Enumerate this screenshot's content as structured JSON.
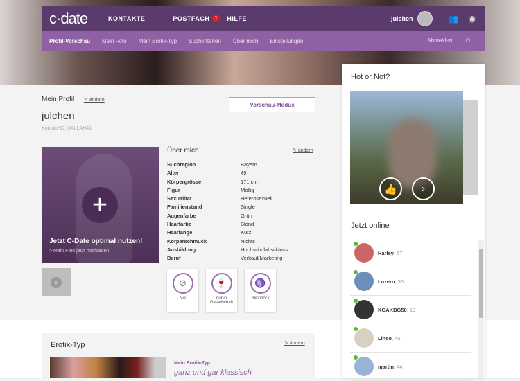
{
  "header": {
    "logo": "c·date",
    "nav": [
      "KONTAKTE",
      "POSTFACH",
      "HILFE"
    ],
    "mail_badge": "1",
    "username": "julchen"
  },
  "subnav": {
    "items": [
      "Profil-Vorschau",
      "Mein Foto",
      "Mein Erotik-Typ",
      "Suchkriterien",
      "Über mich",
      "Einstellungen"
    ],
    "logout": "Abmelden"
  },
  "profile": {
    "title": "Mein Profil",
    "edit": "ändern",
    "name": "julchen",
    "contact_id": "Kontakt-ID: UALLAH41",
    "preview_button": "Vorschau-Modus",
    "photo_title": "Jetzt C-Date optimal nutzen!",
    "photo_link": "> Mein Foto jetzt hochladen"
  },
  "about": {
    "title": "Über mich",
    "edit": "ändern",
    "rows": [
      {
        "k": "Suchregion",
        "v": "Bayern"
      },
      {
        "k": "Alter",
        "v": "49"
      },
      {
        "k": "Körpergrösse",
        "v": "171 cm"
      },
      {
        "k": "Figur",
        "v": "Mollig"
      },
      {
        "k": "Sexualität",
        "v": "Heterosexuell"
      },
      {
        "k": "Familienstand",
        "v": "Single"
      },
      {
        "k": "Augenfarbe",
        "v": "Grün"
      },
      {
        "k": "Haarfarbe",
        "v": "Blond"
      },
      {
        "k": "Haarlänge",
        "v": "Kurz"
      },
      {
        "k": "Körperschmuck",
        "v": "Nichts"
      },
      {
        "k": "Ausbildung",
        "v": "Hochschulabschluss"
      },
      {
        "k": "Beruf",
        "v": "Verkauf/Marketing"
      }
    ],
    "cards": [
      "Nie",
      "nur in Gesellschaft",
      "Steinbock"
    ]
  },
  "hot": {
    "title": "Hot or Not?"
  },
  "online": {
    "title": "Jetzt online",
    "users": [
      {
        "name": "Harley",
        "age": ", 57",
        "color": "#c66"
      },
      {
        "name": "Luzern",
        "age": ", 36",
        "color": "#6a8fb8"
      },
      {
        "name": "KGAKBG50",
        "age": ", 19",
        "color": "#333"
      },
      {
        "name": "Linco",
        "age": ", 45",
        "color": "#d8d0c0"
      },
      {
        "name": "martin",
        "age": ", 44",
        "color": "#9ab4d8"
      }
    ]
  },
  "erotik": {
    "title": "Erotik-Typ",
    "edit": "ändern",
    "label": "Mein Erotik-Typ",
    "value": "ganz und gar klassisch"
  }
}
